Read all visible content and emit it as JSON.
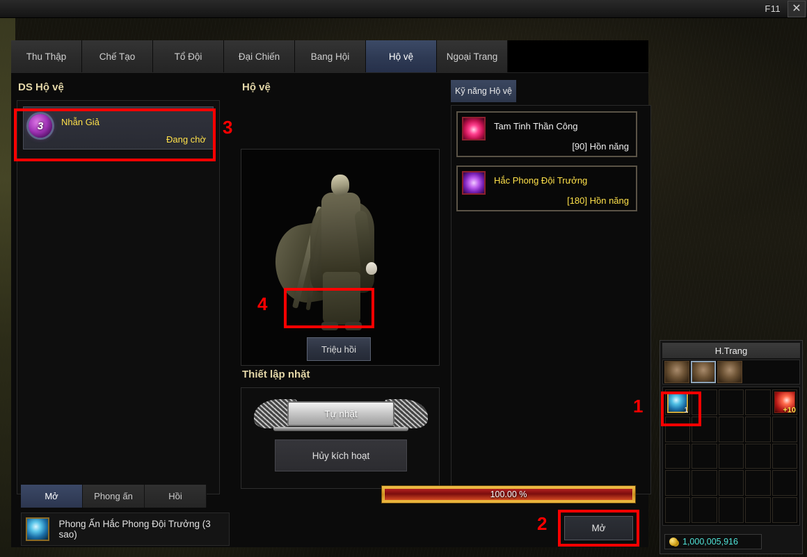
{
  "titlebar": {
    "hotkey": "F11",
    "close_icon": "close-x-icon"
  },
  "tabs": [
    {
      "label": "Thu Thập",
      "selected": false
    },
    {
      "label": "Chế Tạo",
      "selected": false
    },
    {
      "label": "Tổ Đội",
      "selected": false
    },
    {
      "label": "Đại Chiến",
      "selected": false
    },
    {
      "label": "Bang Hội",
      "selected": false
    },
    {
      "label": "Hộ vệ",
      "selected": true
    },
    {
      "label": "Ngoại Trang",
      "selected": false
    }
  ],
  "left": {
    "heading": "DS Hộ vệ",
    "guardian": {
      "star_badge": "3",
      "name": "Nhẫn Giả",
      "status": "Đang chờ"
    }
  },
  "center": {
    "heading": "Hộ vệ",
    "summon_button": "Triệu hồi",
    "setup_heading": "Thiết lập nhặt",
    "auto_pickup_button": "Tự nhặt",
    "deactivate_button": "Hủy kích hoạt"
  },
  "skills": {
    "tab_label": "Kỹ năng Hộ vệ",
    "items": [
      {
        "name": "Tam Tinh Thần Công",
        "cost": "[90] Hồn năng",
        "icon": "fire-skill-icon"
      },
      {
        "name": "Hắc Phong Đội Trưởng",
        "cost": "[180] Hồn năng",
        "icon": "dark-skill-icon"
      }
    ]
  },
  "bottom": {
    "tabs": [
      {
        "label": "Mở",
        "selected": true
      },
      {
        "label": "Phong ấn",
        "selected": false
      },
      {
        "label": "Hồi",
        "selected": false
      }
    ],
    "item_name": "Phong Ấn Hắc Phong Đội Trưởng (3 sao)",
    "item_icon": "blue-orb-icon",
    "progress_text": "100.00 %",
    "progress_value": 100,
    "open_button": "Mở"
  },
  "inventory": {
    "title": "H.Trang",
    "bag_tabs": [
      {
        "icon": "bag-icon",
        "selected": false
      },
      {
        "icon": "bag-icon",
        "selected": true
      },
      {
        "icon": "bag-icon",
        "selected": false
      }
    ],
    "slots": [
      {
        "index": 0,
        "icon": "blue-orb-icon",
        "count": "1",
        "highlighted": true
      },
      {
        "index": 4,
        "icon": "red-flag-icon",
        "count": "+10",
        "highlighted": false
      }
    ],
    "gold": "1,000,005,916",
    "gold_icon": "gold-coin-icon"
  },
  "annotations": [
    {
      "label": "1",
      "target": "inventory-slot-0"
    },
    {
      "label": "2",
      "target": "open-button"
    },
    {
      "label": "3",
      "target": "guardian-list-row"
    },
    {
      "label": "4",
      "target": "summon-button"
    }
  ],
  "colors": {
    "accent_yellow": "#ffe14a",
    "heading_gold": "#e4d7a8",
    "annotation_red": "#ff0000",
    "gold_text": "#4fe3d8"
  }
}
